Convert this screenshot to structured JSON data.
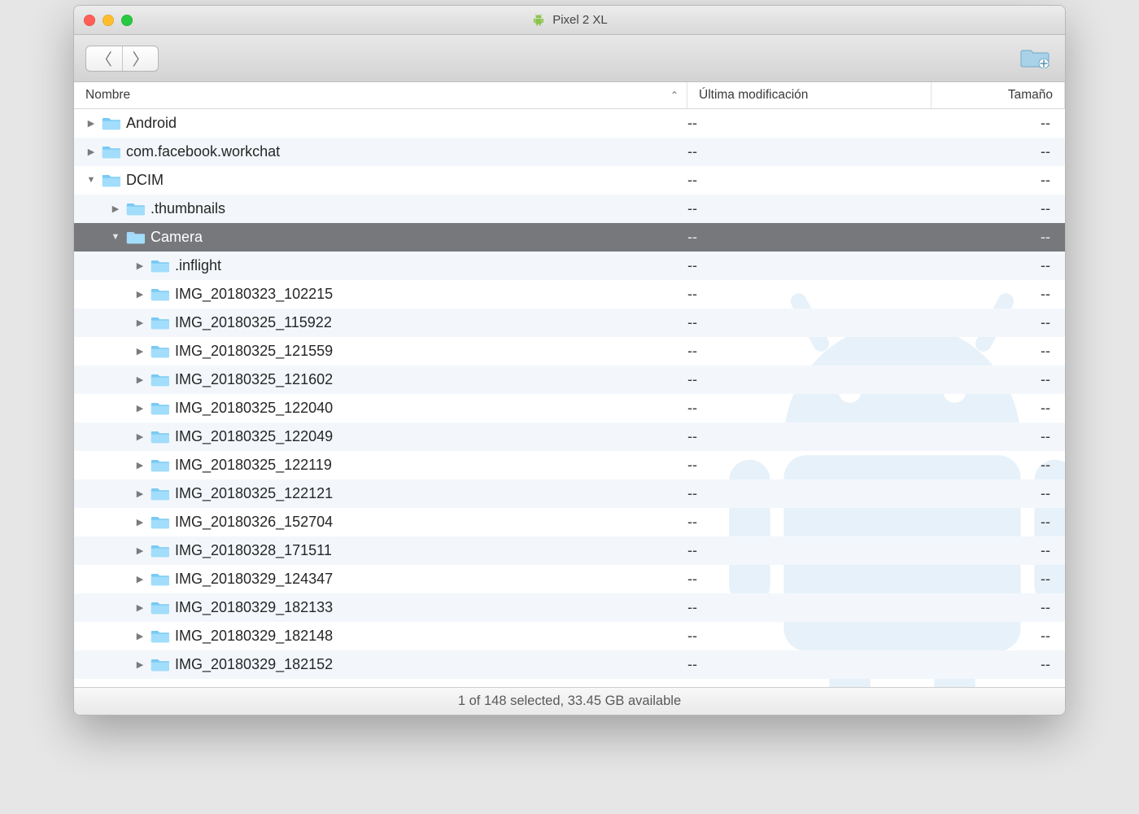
{
  "window": {
    "title": "Pixel 2 XL"
  },
  "columns": {
    "name": "Nombre",
    "modified": "Última modificación",
    "size": "Tamaño"
  },
  "status": "1 of 148 selected, 33.45 GB available",
  "placeholder": {
    "modified": "--",
    "size": "--"
  },
  "rows": [
    {
      "name": "Android",
      "depth": 0,
      "expanded": false,
      "selected": false
    },
    {
      "name": "com.facebook.workchat",
      "depth": 0,
      "expanded": false,
      "selected": false
    },
    {
      "name": "DCIM",
      "depth": 0,
      "expanded": true,
      "selected": false
    },
    {
      "name": ".thumbnails",
      "depth": 1,
      "expanded": false,
      "selected": false
    },
    {
      "name": "Camera",
      "depth": 1,
      "expanded": true,
      "selected": true
    },
    {
      "name": ".inflight",
      "depth": 2,
      "expanded": false,
      "selected": false
    },
    {
      "name": "IMG_20180323_102215",
      "depth": 2,
      "expanded": false,
      "selected": false
    },
    {
      "name": "IMG_20180325_115922",
      "depth": 2,
      "expanded": false,
      "selected": false
    },
    {
      "name": "IMG_20180325_121559",
      "depth": 2,
      "expanded": false,
      "selected": false
    },
    {
      "name": "IMG_20180325_121602",
      "depth": 2,
      "expanded": false,
      "selected": false
    },
    {
      "name": "IMG_20180325_122040",
      "depth": 2,
      "expanded": false,
      "selected": false
    },
    {
      "name": "IMG_20180325_122049",
      "depth": 2,
      "expanded": false,
      "selected": false
    },
    {
      "name": "IMG_20180325_122119",
      "depth": 2,
      "expanded": false,
      "selected": false
    },
    {
      "name": "IMG_20180325_122121",
      "depth": 2,
      "expanded": false,
      "selected": false
    },
    {
      "name": "IMG_20180326_152704",
      "depth": 2,
      "expanded": false,
      "selected": false
    },
    {
      "name": "IMG_20180328_171511",
      "depth": 2,
      "expanded": false,
      "selected": false
    },
    {
      "name": "IMG_20180329_124347",
      "depth": 2,
      "expanded": false,
      "selected": false
    },
    {
      "name": "IMG_20180329_182133",
      "depth": 2,
      "expanded": false,
      "selected": false
    },
    {
      "name": "IMG_20180329_182148",
      "depth": 2,
      "expanded": false,
      "selected": false
    },
    {
      "name": "IMG_20180329_182152",
      "depth": 2,
      "expanded": false,
      "selected": false
    }
  ]
}
